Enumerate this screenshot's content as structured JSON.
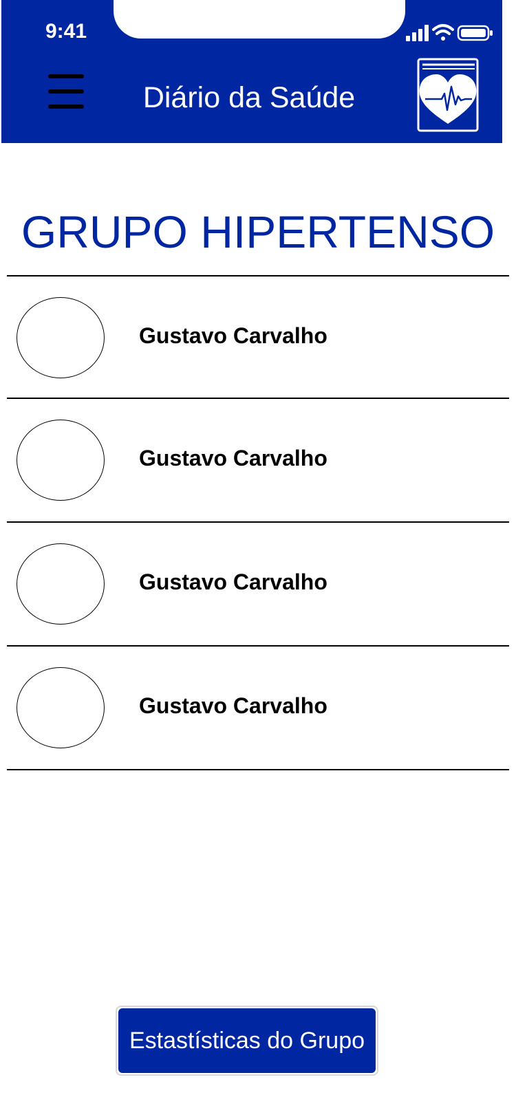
{
  "status_bar": {
    "time": "9:41",
    "icons": [
      "signal-icon",
      "wifi-icon",
      "battery-icon"
    ]
  },
  "header": {
    "title": "Diário da Saúde",
    "menu_icon": "hamburger-menu-icon",
    "logo_icon": "heart-book-logo-icon"
  },
  "page": {
    "title": "GRUPO HIPERTENSO"
  },
  "members": [
    {
      "name": "Gustavo Carvalho"
    },
    {
      "name": "Gustavo Carvalho"
    },
    {
      "name": "Gustavo Carvalho"
    },
    {
      "name": "Gustavo Carvalho"
    }
  ],
  "actions": {
    "stats_label": "Estastísticas do Grupo"
  },
  "colors": {
    "primary": "#0027a1",
    "background": "#ffffff",
    "text": "#000000"
  }
}
